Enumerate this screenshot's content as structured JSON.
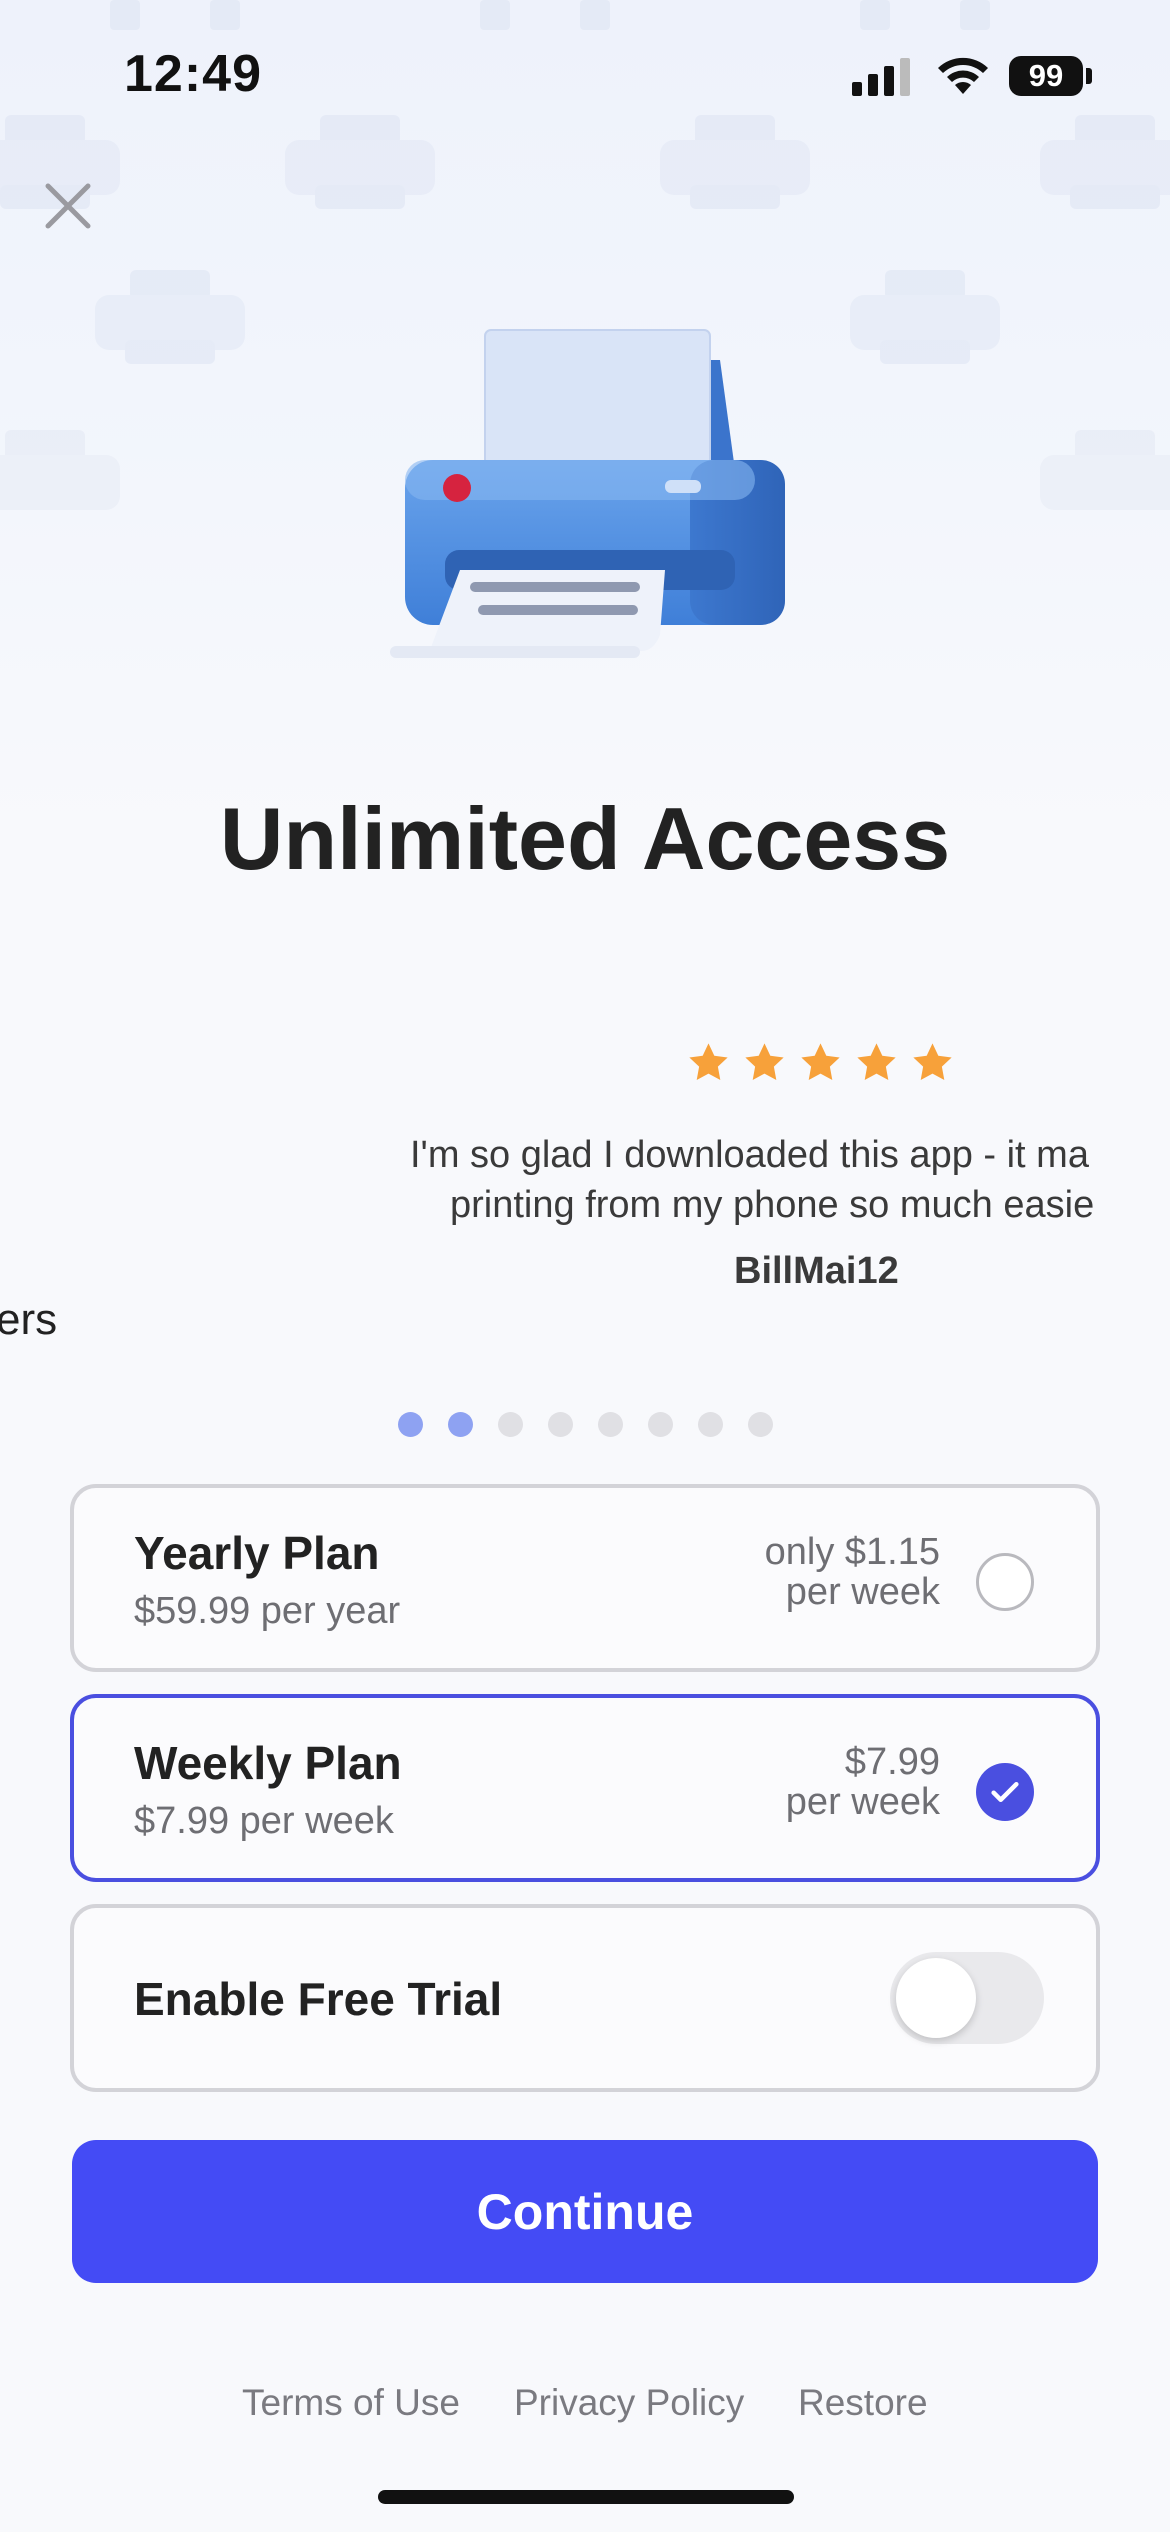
{
  "status_bar": {
    "time": "12:49",
    "battery": "99"
  },
  "header": {
    "title": "Unlimited Access",
    "close_icon": "close-icon"
  },
  "carousel": {
    "rating": 5,
    "review_line1": "I'm so glad I downloaded this app - it ma",
    "review_line2": "printing from my phone so much easie",
    "reviewer": "BillMai12",
    "previous_slide_fragment": "ers",
    "dots_total": 8,
    "dots_active": [
      0,
      1
    ]
  },
  "plans": [
    {
      "name": "Yearly Plan",
      "subtitle": "$59.99 per year",
      "price_line1": "only $1.15",
      "price_line2": "per week",
      "selected": false
    },
    {
      "name": "Weekly Plan",
      "subtitle": "$7.99 per week",
      "price_line1": "$7.99",
      "price_line2": "per week",
      "selected": true
    }
  ],
  "free_trial": {
    "label": "Enable Free Trial",
    "enabled": false
  },
  "cta": {
    "label": "Continue"
  },
  "footer": {
    "terms": "Terms of Use",
    "privacy": "Privacy Policy",
    "restore": "Restore"
  },
  "colors": {
    "accent": "#444bf5",
    "selected_border": "#4a4fe0",
    "star": "#f7a13a",
    "dot_active": "#8ea2f2"
  }
}
